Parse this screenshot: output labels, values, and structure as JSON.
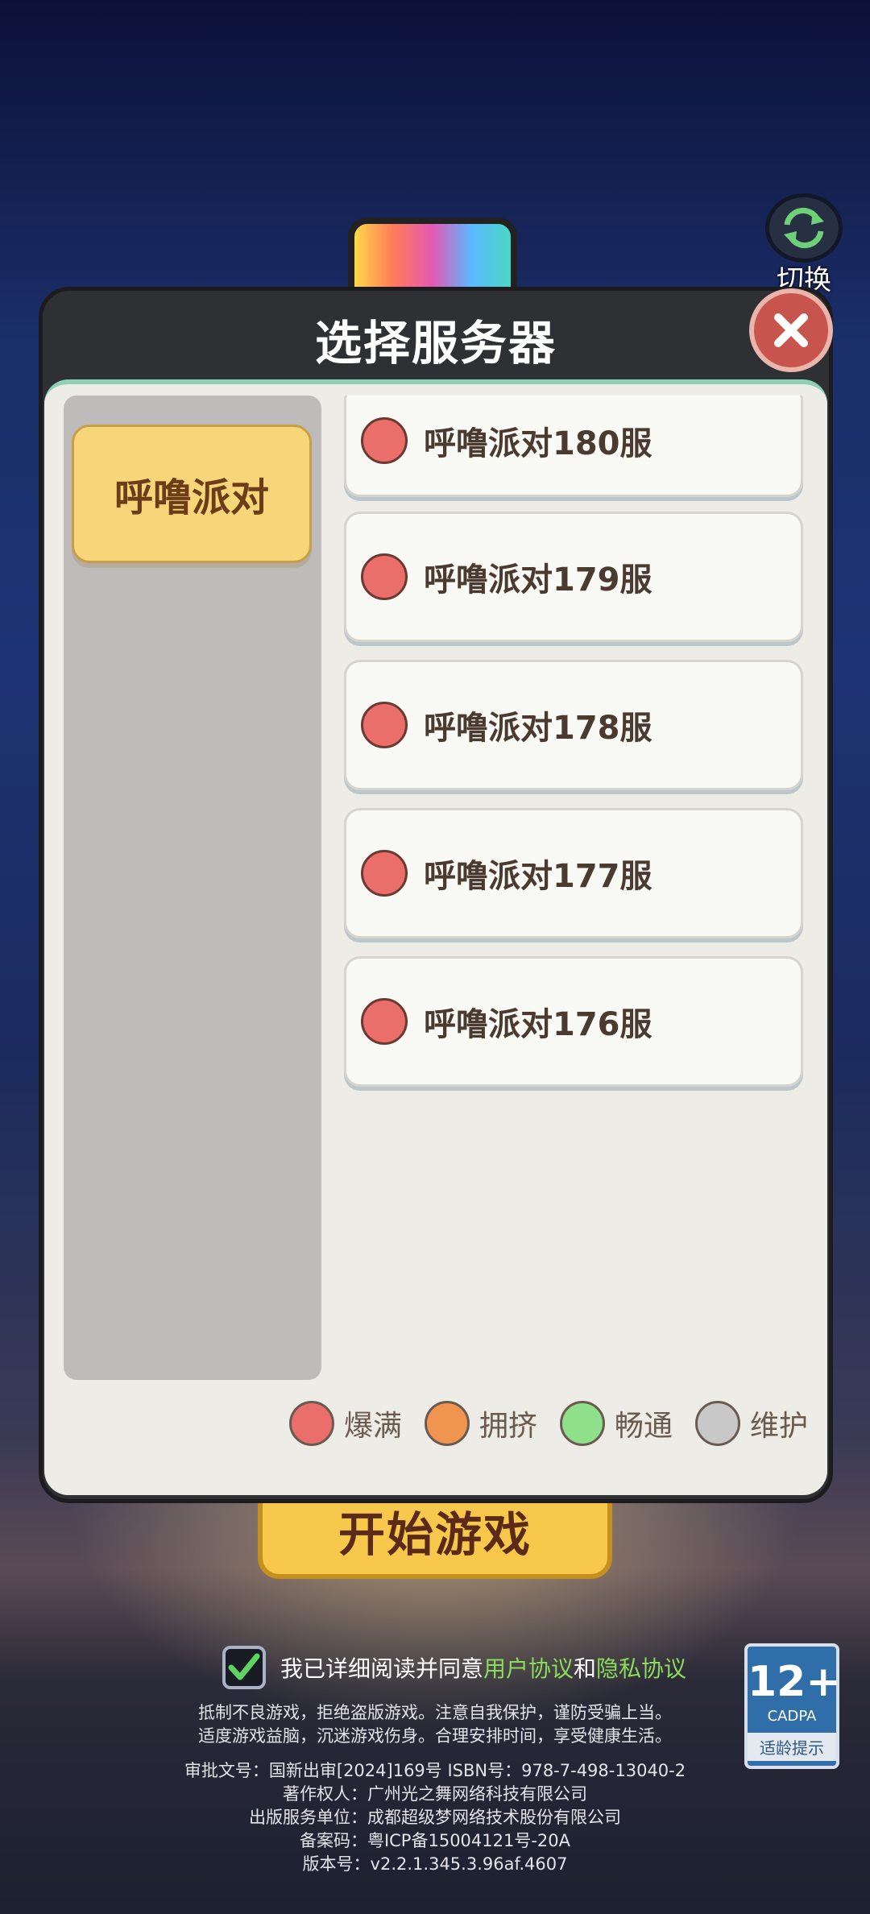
{
  "top_button": {
    "label": "切换"
  },
  "dialog": {
    "title": "选择服务器",
    "category_tab": "呼噜派对",
    "servers": [
      {
        "name": "呼噜派对180服",
        "status": "爆满"
      },
      {
        "name": "呼噜派对179服",
        "status": "爆满"
      },
      {
        "name": "呼噜派对178服",
        "status": "爆满"
      },
      {
        "name": "呼噜派对177服",
        "status": "爆满"
      },
      {
        "name": "呼噜派对176服",
        "status": "爆满"
      }
    ],
    "legend": [
      {
        "label": "爆满",
        "color": "#ea6e6a"
      },
      {
        "label": "拥挤",
        "color": "#ef9550"
      },
      {
        "label": "畅通",
        "color": "#8fe08a"
      },
      {
        "label": "维护",
        "color": "#c8c8c8"
      }
    ]
  },
  "start_button": {
    "label": "开始游戏"
  },
  "agreement": {
    "prefix": "我已详细阅读并同意",
    "user_agreement": "用户协议",
    "and": "和",
    "privacy_agreement": "隐私协议",
    "checked": true
  },
  "footer": {
    "health_line1": "抵制不良游戏，拒绝盗版游戏。注意自我保护，谨防受骗上当。",
    "health_line2": "适度游戏益脑，沉迷游戏伤身。合理安排时间，享受健康生活。",
    "approval": "审批文号：国新出审[2024]169号 ISBN号：978-7-498-13040-2",
    "copyright": "著作权人：广州光之舞网络科技有限公司",
    "publisher": "出版服务单位：成都超级梦网络技术股份有限公司",
    "icp": "备案码：粤ICP备15004121号-20A",
    "version": "版本号：v2.2.1.345.3.96af.4607"
  },
  "age_rating": {
    "number": "12+",
    "org": "CADPA",
    "tip": "适龄提示"
  }
}
